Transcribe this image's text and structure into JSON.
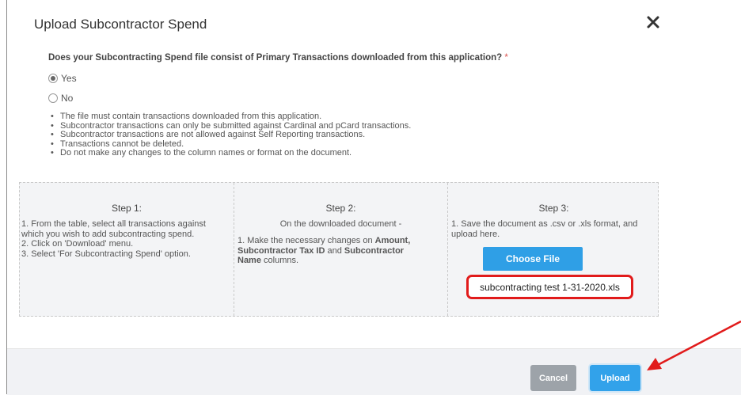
{
  "modal": {
    "title": "Upload Subcontractor Spend",
    "close_icon": "close-icon"
  },
  "question": {
    "text": "Does your Subcontracting Spend file consist of Primary Transactions downloaded from this application?",
    "required_mark": "*",
    "options": [
      {
        "label": "Yes",
        "selected": true
      },
      {
        "label": "No",
        "selected": false
      }
    ]
  },
  "notes": [
    "The file must contain transactions downloaded from this application.",
    "Subcontractor transactions can only be submitted against Cardinal and pCard transactions.",
    "Subcontractor transactions are not allowed against Self Reporting transactions.",
    "Transactions cannot be deleted.",
    "Do not make any changes to the column names or format on the document."
  ],
  "steps": {
    "step1": {
      "title": "Step 1:",
      "lines": [
        "1. From the table, select all transactions against",
        "which you wish to add subcontracting spend.",
        "2. Click on 'Download' menu.",
        "3. Select 'For Subcontracting Spend' option."
      ]
    },
    "step2": {
      "title": "Step 2:",
      "intro": "On the downloaded document -",
      "line1_prefix": "1. Make the necessary changes on ",
      "bold_amount": "Amount,",
      "bold_taxid": "Subcontractor Tax ID",
      "and_text": " and ",
      "bold_name1": "Subcontractor",
      "bold_name2": "Name",
      "columns_text": " columns."
    },
    "step3": {
      "title": "Step 3:",
      "lines": [
        "1. Save the document as .csv or .xls format, and",
        "upload here."
      ],
      "choose_label": "Choose File",
      "file_name": "subcontracting test 1-31-2020.xls"
    }
  },
  "footer": {
    "cancel_label": "Cancel",
    "upload_label": "Upload"
  },
  "colors": {
    "primary": "#32a2ea",
    "secondary": "#9da3a9",
    "highlight": "#e11b1b"
  }
}
